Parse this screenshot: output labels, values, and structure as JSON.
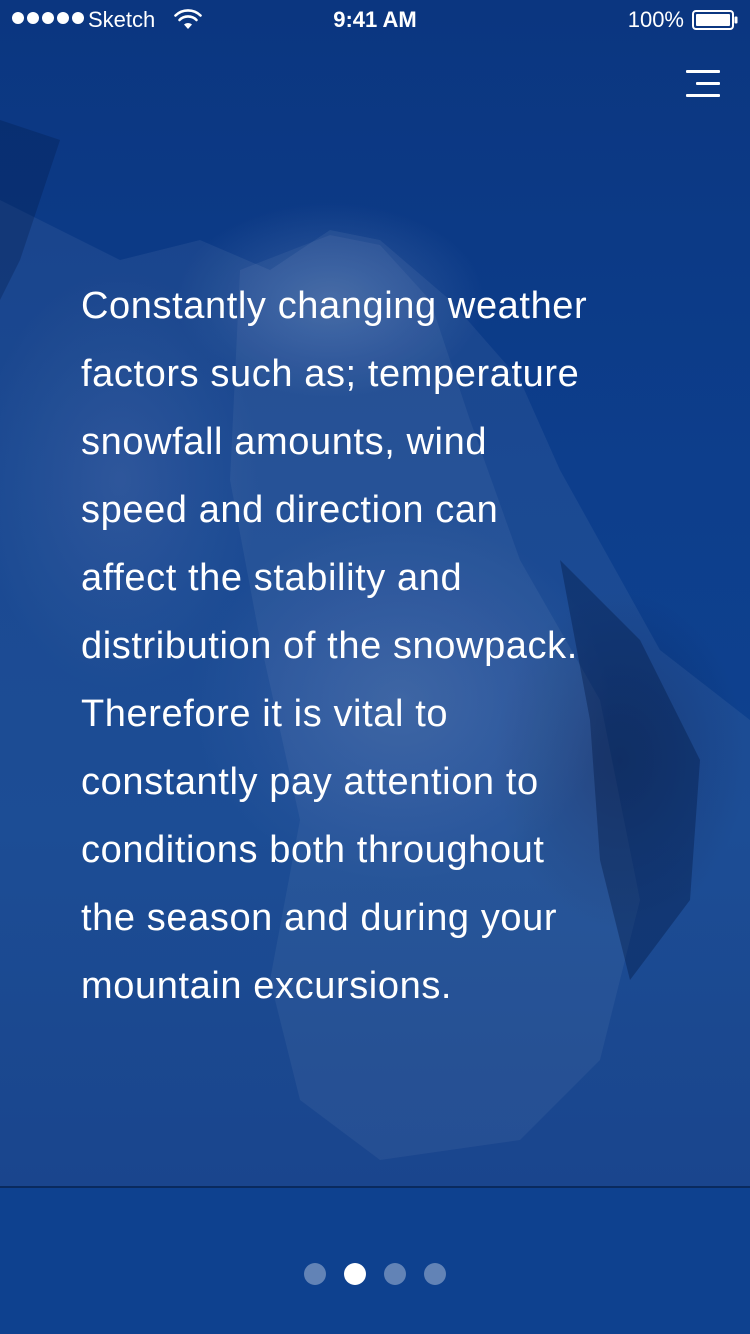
{
  "status_bar": {
    "carrier": "Sketch",
    "time": "9:41 AM",
    "battery": "100%"
  },
  "header": {
    "menu_icon": "hamburger-menu-icon"
  },
  "content": {
    "lines": [
      "Constantly changing weather",
      "factors such as; temperature",
      "snowfall amounts, wind",
      "speed and direction can",
      "affect the stability and",
      "distribution of the snowpack.",
      "Therefore it is vital to",
      "constantly pay attention to",
      "conditions both throughout",
      "the season and during your",
      "mountain excursions."
    ]
  },
  "pagination": {
    "total": 4,
    "current": 2
  },
  "colors": {
    "background": "#0d3a85",
    "footer": "#0e418f",
    "text": "#ffffff"
  }
}
